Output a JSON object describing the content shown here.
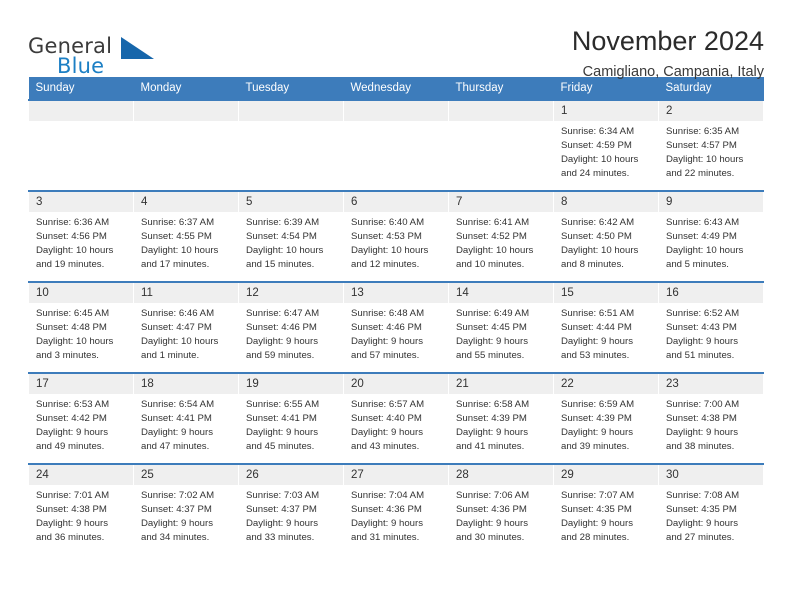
{
  "brand": {
    "name_part1": "General",
    "name_part2": "Blue",
    "triangle_color": "#1666ab",
    "blue_text_color": "#1c7fc4"
  },
  "header": {
    "title": "November 2024",
    "subtitle": "Camigliano, Campania, Italy",
    "accent_color": "#3d7cbb",
    "daynum_band_color": "#efefef"
  },
  "weekday_headers": [
    "Sunday",
    "Monday",
    "Tuesday",
    "Wednesday",
    "Thursday",
    "Friday",
    "Saturday"
  ],
  "weeks": [
    [
      {
        "day": "",
        "empty": true
      },
      {
        "day": "",
        "empty": true
      },
      {
        "day": "",
        "empty": true
      },
      {
        "day": "",
        "empty": true
      },
      {
        "day": "",
        "empty": true
      },
      {
        "day": "1",
        "sunrise": "Sunrise: 6:34 AM",
        "sunset": "Sunset: 4:59 PM",
        "daylight_line1": "Daylight: 10 hours",
        "daylight_line2": "and 24 minutes."
      },
      {
        "day": "2",
        "sunrise": "Sunrise: 6:35 AM",
        "sunset": "Sunset: 4:57 PM",
        "daylight_line1": "Daylight: 10 hours",
        "daylight_line2": "and 22 minutes."
      }
    ],
    [
      {
        "day": "3",
        "sunrise": "Sunrise: 6:36 AM",
        "sunset": "Sunset: 4:56 PM",
        "daylight_line1": "Daylight: 10 hours",
        "daylight_line2": "and 19 minutes."
      },
      {
        "day": "4",
        "sunrise": "Sunrise: 6:37 AM",
        "sunset": "Sunset: 4:55 PM",
        "daylight_line1": "Daylight: 10 hours",
        "daylight_line2": "and 17 minutes."
      },
      {
        "day": "5",
        "sunrise": "Sunrise: 6:39 AM",
        "sunset": "Sunset: 4:54 PM",
        "daylight_line1": "Daylight: 10 hours",
        "daylight_line2": "and 15 minutes."
      },
      {
        "day": "6",
        "sunrise": "Sunrise: 6:40 AM",
        "sunset": "Sunset: 4:53 PM",
        "daylight_line1": "Daylight: 10 hours",
        "daylight_line2": "and 12 minutes."
      },
      {
        "day": "7",
        "sunrise": "Sunrise: 6:41 AM",
        "sunset": "Sunset: 4:52 PM",
        "daylight_line1": "Daylight: 10 hours",
        "daylight_line2": "and 10 minutes."
      },
      {
        "day": "8",
        "sunrise": "Sunrise: 6:42 AM",
        "sunset": "Sunset: 4:50 PM",
        "daylight_line1": "Daylight: 10 hours",
        "daylight_line2": "and 8 minutes."
      },
      {
        "day": "9",
        "sunrise": "Sunrise: 6:43 AM",
        "sunset": "Sunset: 4:49 PM",
        "daylight_line1": "Daylight: 10 hours",
        "daylight_line2": "and 5 minutes."
      }
    ],
    [
      {
        "day": "10",
        "sunrise": "Sunrise: 6:45 AM",
        "sunset": "Sunset: 4:48 PM",
        "daylight_line1": "Daylight: 10 hours",
        "daylight_line2": "and 3 minutes."
      },
      {
        "day": "11",
        "sunrise": "Sunrise: 6:46 AM",
        "sunset": "Sunset: 4:47 PM",
        "daylight_line1": "Daylight: 10 hours",
        "daylight_line2": "and 1 minute."
      },
      {
        "day": "12",
        "sunrise": "Sunrise: 6:47 AM",
        "sunset": "Sunset: 4:46 PM",
        "daylight_line1": "Daylight: 9 hours",
        "daylight_line2": "and 59 minutes."
      },
      {
        "day": "13",
        "sunrise": "Sunrise: 6:48 AM",
        "sunset": "Sunset: 4:46 PM",
        "daylight_line1": "Daylight: 9 hours",
        "daylight_line2": "and 57 minutes."
      },
      {
        "day": "14",
        "sunrise": "Sunrise: 6:49 AM",
        "sunset": "Sunset: 4:45 PM",
        "daylight_line1": "Daylight: 9 hours",
        "daylight_line2": "and 55 minutes."
      },
      {
        "day": "15",
        "sunrise": "Sunrise: 6:51 AM",
        "sunset": "Sunset: 4:44 PM",
        "daylight_line1": "Daylight: 9 hours",
        "daylight_line2": "and 53 minutes."
      },
      {
        "day": "16",
        "sunrise": "Sunrise: 6:52 AM",
        "sunset": "Sunset: 4:43 PM",
        "daylight_line1": "Daylight: 9 hours",
        "daylight_line2": "and 51 minutes."
      }
    ],
    [
      {
        "day": "17",
        "sunrise": "Sunrise: 6:53 AM",
        "sunset": "Sunset: 4:42 PM",
        "daylight_line1": "Daylight: 9 hours",
        "daylight_line2": "and 49 minutes."
      },
      {
        "day": "18",
        "sunrise": "Sunrise: 6:54 AM",
        "sunset": "Sunset: 4:41 PM",
        "daylight_line1": "Daylight: 9 hours",
        "daylight_line2": "and 47 minutes."
      },
      {
        "day": "19",
        "sunrise": "Sunrise: 6:55 AM",
        "sunset": "Sunset: 4:41 PM",
        "daylight_line1": "Daylight: 9 hours",
        "daylight_line2": "and 45 minutes."
      },
      {
        "day": "20",
        "sunrise": "Sunrise: 6:57 AM",
        "sunset": "Sunset: 4:40 PM",
        "daylight_line1": "Daylight: 9 hours",
        "daylight_line2": "and 43 minutes."
      },
      {
        "day": "21",
        "sunrise": "Sunrise: 6:58 AM",
        "sunset": "Sunset: 4:39 PM",
        "daylight_line1": "Daylight: 9 hours",
        "daylight_line2": "and 41 minutes."
      },
      {
        "day": "22",
        "sunrise": "Sunrise: 6:59 AM",
        "sunset": "Sunset: 4:39 PM",
        "daylight_line1": "Daylight: 9 hours",
        "daylight_line2": "and 39 minutes."
      },
      {
        "day": "23",
        "sunrise": "Sunrise: 7:00 AM",
        "sunset": "Sunset: 4:38 PM",
        "daylight_line1": "Daylight: 9 hours",
        "daylight_line2": "and 38 minutes."
      }
    ],
    [
      {
        "day": "24",
        "sunrise": "Sunrise: 7:01 AM",
        "sunset": "Sunset: 4:38 PM",
        "daylight_line1": "Daylight: 9 hours",
        "daylight_line2": "and 36 minutes."
      },
      {
        "day": "25",
        "sunrise": "Sunrise: 7:02 AM",
        "sunset": "Sunset: 4:37 PM",
        "daylight_line1": "Daylight: 9 hours",
        "daylight_line2": "and 34 minutes."
      },
      {
        "day": "26",
        "sunrise": "Sunrise: 7:03 AM",
        "sunset": "Sunset: 4:37 PM",
        "daylight_line1": "Daylight: 9 hours",
        "daylight_line2": "and 33 minutes."
      },
      {
        "day": "27",
        "sunrise": "Sunrise: 7:04 AM",
        "sunset": "Sunset: 4:36 PM",
        "daylight_line1": "Daylight: 9 hours",
        "daylight_line2": "and 31 minutes."
      },
      {
        "day": "28",
        "sunrise": "Sunrise: 7:06 AM",
        "sunset": "Sunset: 4:36 PM",
        "daylight_line1": "Daylight: 9 hours",
        "daylight_line2": "and 30 minutes."
      },
      {
        "day": "29",
        "sunrise": "Sunrise: 7:07 AM",
        "sunset": "Sunset: 4:35 PM",
        "daylight_line1": "Daylight: 9 hours",
        "daylight_line2": "and 28 minutes."
      },
      {
        "day": "30",
        "sunrise": "Sunrise: 7:08 AM",
        "sunset": "Sunset: 4:35 PM",
        "daylight_line1": "Daylight: 9 hours",
        "daylight_line2": "and 27 minutes."
      }
    ]
  ]
}
